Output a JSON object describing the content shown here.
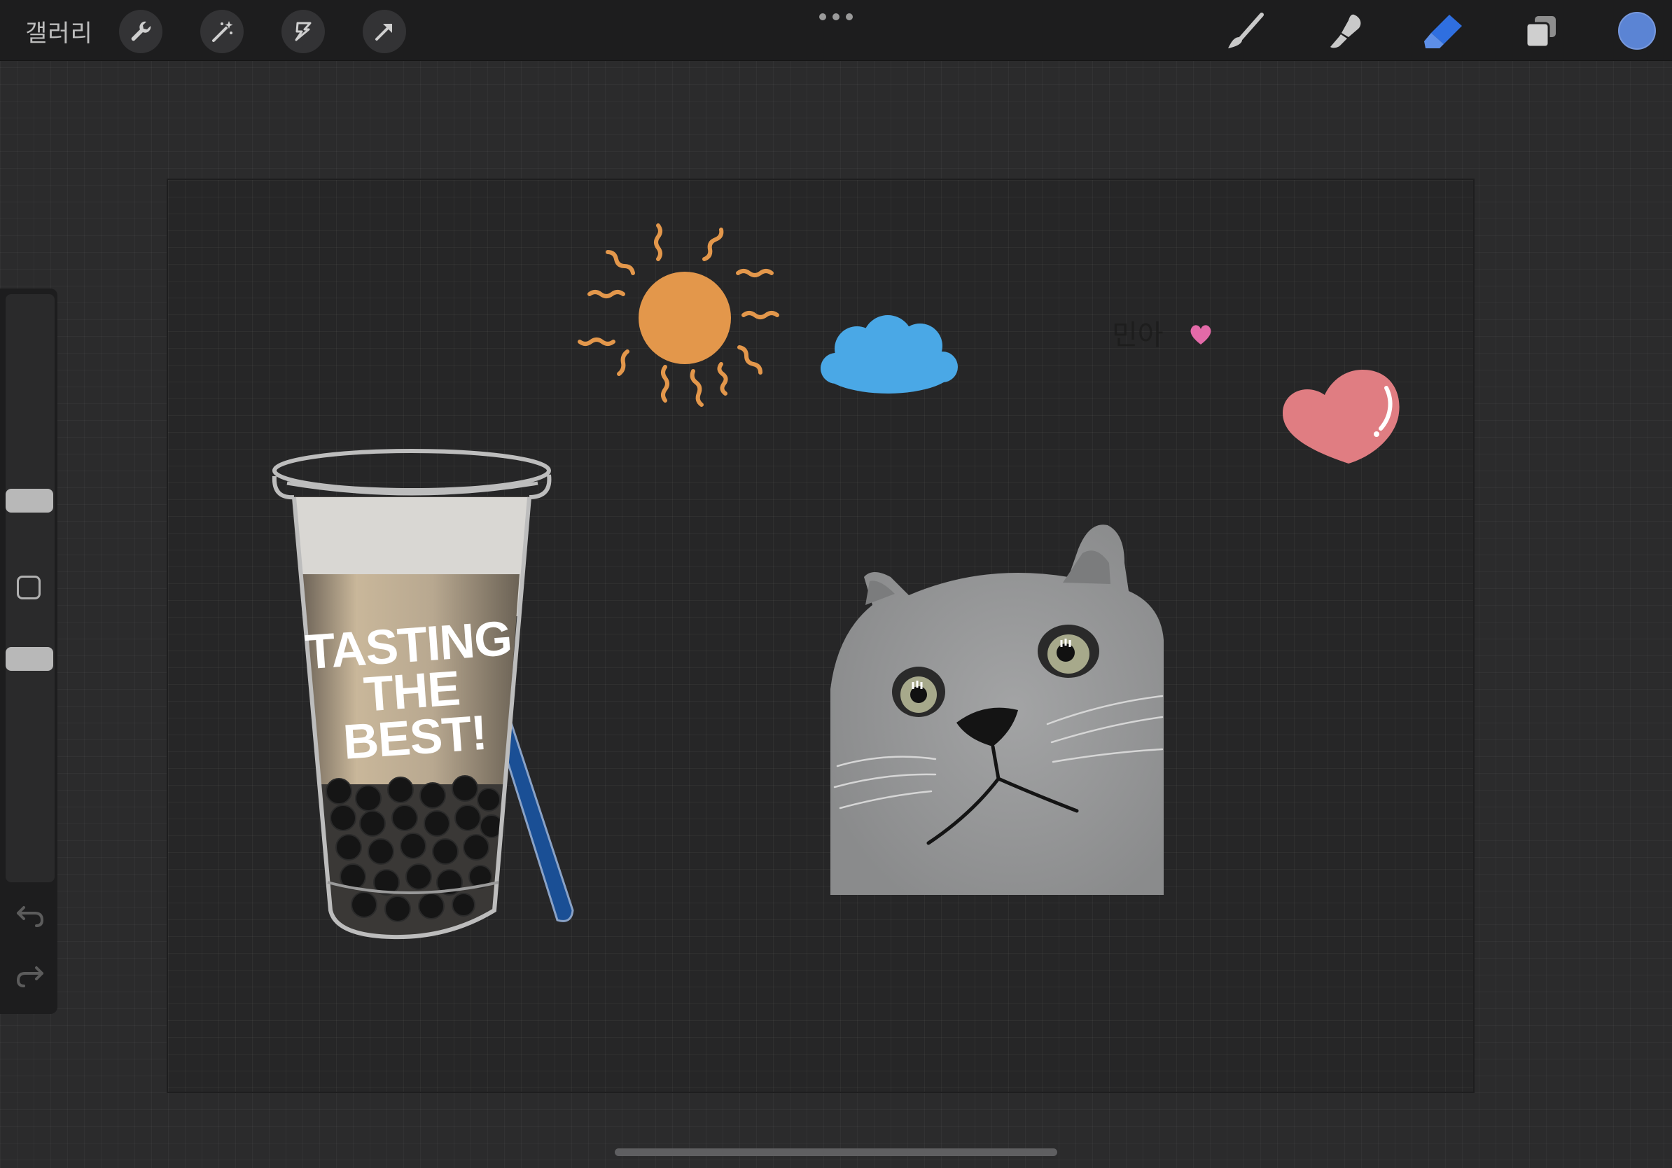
{
  "topbar": {
    "gallery_label": "갤러리",
    "left_tools": [
      "wrench-icon",
      "magic-wand-icon",
      "selection-icon",
      "transform-arrow-icon"
    ],
    "right_tools": [
      "brush-icon",
      "smudge-icon",
      "eraser-icon",
      "layers-icon"
    ],
    "active_tool": "eraser-icon",
    "accent_color": "#2f6fe0",
    "current_color": "#5b84d4"
  },
  "sidebar": {
    "brush_size_level": 0.34,
    "opacity_level": 0.6
  },
  "canvas": {
    "drink_text": [
      "TASTING",
      "THE",
      "BEST!"
    ],
    "handwriting": "민아",
    "colors": {
      "sun": "#e3974b",
      "cloud": "#4aa8e6",
      "heart": "#e07d82",
      "cat": "#8f9091",
      "straw": "#1a4f95"
    }
  }
}
